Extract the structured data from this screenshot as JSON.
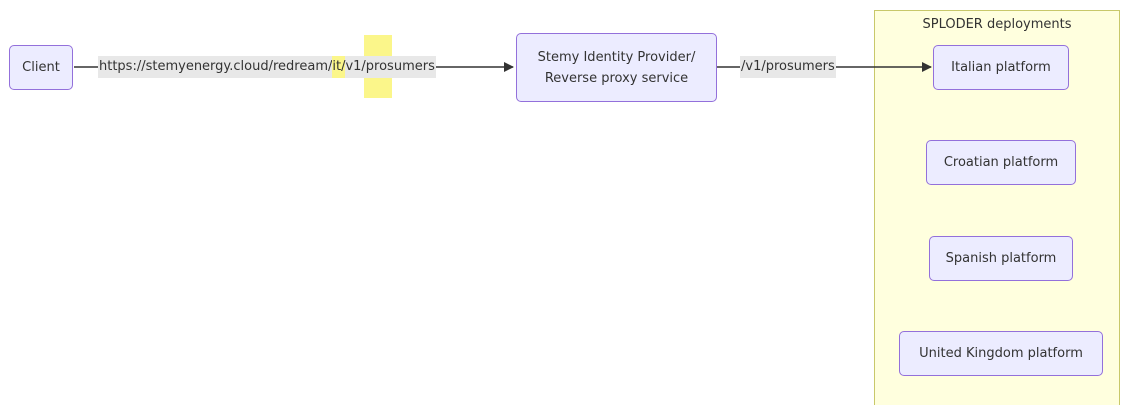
{
  "cluster": {
    "title": "SPLODER deployments"
  },
  "nodes": {
    "client": "Client",
    "idp_line1": "Stemy Identity Provider/",
    "idp_line2": "Reverse proxy service",
    "italian": "Italian platform",
    "croatian": "Croatian platform",
    "spanish": "Spanish platform",
    "uk": "United Kingdom platform"
  },
  "edges": {
    "client_to_idp": {
      "prefix": "https://stemyenergy.cloud/redream/",
      "highlight": "it/",
      "suffix": "v1/prosumers"
    },
    "idp_to_italian": "/v1/prosumers"
  },
  "colors": {
    "node_fill": "#ececff",
    "node_border": "#9370db",
    "cluster_fill": "#ffffde",
    "cluster_border": "#c8c86a",
    "highlight": "#fbf68a",
    "edge": "#333333"
  }
}
